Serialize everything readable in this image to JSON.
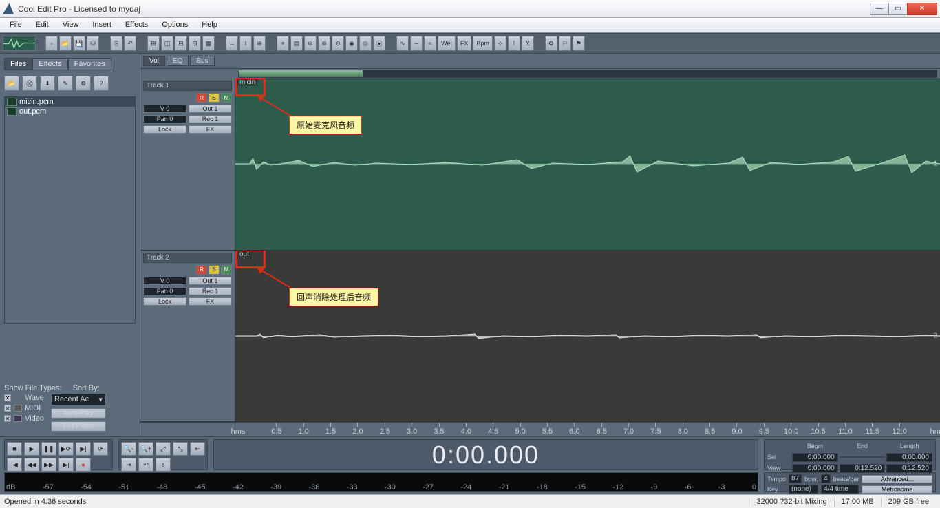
{
  "window": {
    "title": "Cool Edit Pro  - Licensed to mydaj"
  },
  "menu": [
    "File",
    "Edit",
    "View",
    "Insert",
    "Effects",
    "Options",
    "Help"
  ],
  "toolbar": {
    "wet": "Wet",
    "fx": "FX",
    "bpm": "Bpm"
  },
  "files_panel": {
    "tabs": [
      "Files",
      "Effects",
      "Favorites"
    ],
    "active_tab": 0,
    "items": [
      {
        "name": "micin.pcm",
        "selected": true
      },
      {
        "name": "out.pcm",
        "selected": false
      }
    ],
    "show_types_label": "Show File Types:",
    "sort_by_label": "Sort By:",
    "types": [
      "Wave",
      "MIDI",
      "Video"
    ],
    "recent": "Recent Ac",
    "autoplay": "Auto-Play",
    "fullpaths": "Full Paths"
  },
  "mix_tabs": [
    "Vol",
    "EQ",
    "Bus"
  ],
  "tracks": [
    {
      "title": "Track 1",
      "rsm": [
        "R",
        "S",
        "M"
      ],
      "v": "V 0",
      "out": "Out 1",
      "pan": "Pan 0",
      "rec": "Rec 1",
      "lock": "Lock",
      "fx": "FX",
      "clip": "micin",
      "index": "1",
      "anno": "原始麦克风音频"
    },
    {
      "title": "Track 2",
      "rsm": [
        "R",
        "S",
        "M"
      ],
      "v": "V 0",
      "out": "Out 1",
      "pan": "Pan 0",
      "rec": "Rec 1",
      "lock": "Lock",
      "fx": "FX",
      "clip": "out",
      "index": "2",
      "anno": "回声消除处理后音频"
    }
  ],
  "ruler": {
    "unit_left": "hms",
    "unit_right": "hms",
    "ticks": [
      "0.5",
      "1.0",
      "1.5",
      "2.0",
      "2.5",
      "3.0",
      "3.5",
      "4.0",
      "4.5",
      "5.0",
      "5.5",
      "6.0",
      "6.5",
      "7.0",
      "7.5",
      "8.0",
      "8.5",
      "9.0",
      "9.5",
      "10.0",
      "10.5",
      "11.0",
      "11.5",
      "12.0"
    ]
  },
  "big_time": "0:00.000",
  "sel_info": {
    "headers": [
      "Begin",
      "End",
      "Length"
    ],
    "rows": [
      {
        "label": "Sel",
        "vals": [
          "0:00.000",
          "",
          "0:00.000"
        ]
      },
      {
        "label": "View",
        "vals": [
          "0:00.000",
          "0:12.520",
          "0:12.520"
        ]
      }
    ]
  },
  "tempo": {
    "tempo_label": "Tempo",
    "tempo_val": "87",
    "bpm": "bpm,",
    "beats_val": "4",
    "beats_bar": "beats/bar",
    "adv": "Advanced...",
    "key_label": "Key",
    "key_val": "(none)",
    "time_val": "4/4 time",
    "metro": "Metronome"
  },
  "level_scale": [
    "dB",
    "-57",
    "-54",
    "-51",
    "-48",
    "-45",
    "-42",
    "-39",
    "-36",
    "-33",
    "-30",
    "-27",
    "-24",
    "-21",
    "-18",
    "-15",
    "-12",
    "-9",
    "-6",
    "-3",
    "0"
  ],
  "status": {
    "opened": "Opened in 4.36 seconds",
    "mix": "32000 ?32-bit Mixing",
    "mem": "17.00 MB",
    "disk": "209 GB free"
  }
}
